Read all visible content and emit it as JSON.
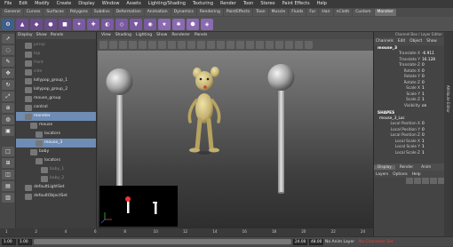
{
  "menubar": [
    "File",
    "Edit",
    "Modify",
    "Create",
    "Display",
    "Window",
    "Assets",
    "Lighting/Shading",
    "Texturing",
    "Render",
    "Toon",
    "Stereo",
    "Paint Effects",
    "Help"
  ],
  "shelf_tabs": [
    {
      "label": "General",
      "active": false
    },
    {
      "label": "Curves",
      "active": false
    },
    {
      "label": "Surfaces",
      "active": false
    },
    {
      "label": "Polygons",
      "active": false
    },
    {
      "label": "Subdivs",
      "active": false
    },
    {
      "label": "Deformation",
      "active": false
    },
    {
      "label": "Animation",
      "active": false
    },
    {
      "label": "Dynamics",
      "active": false
    },
    {
      "label": "Rendering",
      "active": false
    },
    {
      "label": "PaintEffects",
      "active": false
    },
    {
      "label": "Toon",
      "active": false
    },
    {
      "label": "Muscle",
      "active": false
    },
    {
      "label": "Fluids",
      "active": false
    },
    {
      "label": "Fur",
      "active": false
    },
    {
      "label": "Hair",
      "active": false
    },
    {
      "label": "nCloth",
      "active": false
    },
    {
      "label": "Custom",
      "active": false
    },
    {
      "label": "Monster",
      "active": true
    }
  ],
  "outliner": {
    "menu": [
      "Display",
      "Show",
      "Panels"
    ],
    "rows": [
      {
        "label": "persp",
        "indent": 1,
        "dim": true,
        "sel": false
      },
      {
        "label": "top",
        "indent": 1,
        "dim": true,
        "sel": false
      },
      {
        "label": "front",
        "indent": 1,
        "dim": true,
        "sel": false
      },
      {
        "label": "side",
        "indent": 1,
        "dim": true,
        "sel": false
      },
      {
        "label": "lollypop_group_1",
        "indent": 1,
        "dim": false,
        "sel": false
      },
      {
        "label": "lollypop_group_2",
        "indent": 1,
        "dim": false,
        "sel": false
      },
      {
        "label": "mouse_group",
        "indent": 1,
        "dim": false,
        "sel": false
      },
      {
        "label": "control",
        "indent": 1,
        "dim": false,
        "sel": false
      },
      {
        "label": "monster",
        "indent": 1,
        "dim": false,
        "sel": true
      },
      {
        "label": "mouse",
        "indent": 2,
        "dim": false,
        "sel": false
      },
      {
        "label": "locators",
        "indent": 3,
        "dim": false,
        "sel": false
      },
      {
        "label": "mouse_3",
        "indent": 3,
        "dim": false,
        "sel": true
      },
      {
        "label": "baby",
        "indent": 2,
        "dim": false,
        "sel": false
      },
      {
        "label": "locators",
        "indent": 3,
        "dim": false,
        "sel": false
      },
      {
        "label": "baby_1",
        "indent": 4,
        "dim": true,
        "sel": false
      },
      {
        "label": "baby_2",
        "indent": 4,
        "dim": true,
        "sel": false
      },
      {
        "label": "defaultLightSet",
        "indent": 1,
        "dim": false,
        "sel": false
      },
      {
        "label": "defaultObjectSet",
        "indent": 1,
        "dim": false,
        "sel": false
      }
    ]
  },
  "viewport": {
    "menu": [
      "View",
      "Shading",
      "Lighting",
      "Show",
      "Renderer",
      "Panels"
    ]
  },
  "channelbox": {
    "header_tabs": [
      "Channels",
      "Edit",
      "Object",
      "Show"
    ],
    "header_title": "Channel Box / Layer Editor",
    "object": "mouse_3",
    "channels": [
      {
        "k": "Translate X",
        "v": "-6.911"
      },
      {
        "k": "Translate Y",
        "v": "16.128"
      },
      {
        "k": "Translate Z",
        "v": "0"
      },
      {
        "k": "Rotate X",
        "v": "0"
      },
      {
        "k": "Rotate Y",
        "v": "0"
      },
      {
        "k": "Rotate Z",
        "v": "0"
      },
      {
        "k": "Scale X",
        "v": "1"
      },
      {
        "k": "Scale Y",
        "v": "1"
      },
      {
        "k": "Scale Z",
        "v": "1"
      },
      {
        "k": "Visibility",
        "v": "on"
      }
    ],
    "shapes_label": "SHAPES",
    "shape_name": "mouse_3_Loc",
    "shape_channels": [
      {
        "k": "Local Position X",
        "v": "0"
      },
      {
        "k": "Local Position Y",
        "v": "0"
      },
      {
        "k": "Local Position Z",
        "v": "0"
      },
      {
        "k": "Local Scale X",
        "v": "1"
      },
      {
        "k": "Local Scale Y",
        "v": "1"
      },
      {
        "k": "Local Scale Z",
        "v": "1"
      }
    ],
    "layer_tabs": [
      "Display",
      "Render",
      "Anim"
    ],
    "layer_menu": [
      "Layers",
      "Options",
      "Help"
    ]
  },
  "attr_strip": "Attribute Editor",
  "rangebar": {
    "start": "1.00",
    "start2": "1.00",
    "end": "24.00",
    "end2": "48.00",
    "anim_layer": "No Anim Layer",
    "char_set": "No Character Set",
    "frame": "1.00"
  },
  "timeline_ticks": [
    "1",
    "2",
    "4",
    "6",
    "8",
    "10",
    "12",
    "14",
    "16",
    "18",
    "20",
    "22",
    "24"
  ],
  "colors": {
    "selection": "#6e8cb4",
    "bg": "#444444"
  }
}
